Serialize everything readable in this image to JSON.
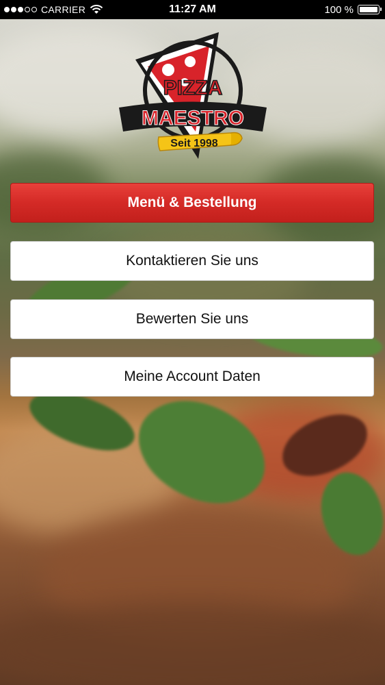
{
  "status_bar": {
    "signal_dots": [
      true,
      true,
      true,
      false,
      false
    ],
    "carrier": "CARRIER",
    "time": "11:27 AM",
    "battery_level": "100 %",
    "icons": [
      "signal-dots-icon",
      "wifi-icon",
      "battery-icon"
    ]
  },
  "logo": {
    "brand_top": "PIZZA",
    "brand_main": "MAESTRO",
    "since": "Seit 1998"
  },
  "menu": {
    "primary_label": "Menü & Bestellung",
    "contact_label": "Kontaktieren Sie uns",
    "rate_label": "Bewerten Sie uns",
    "account_label": "Meine Account Daten"
  },
  "colors": {
    "primary_button": "#d42a26",
    "secondary_button": "#ffffff",
    "status_bar": "#000000"
  }
}
